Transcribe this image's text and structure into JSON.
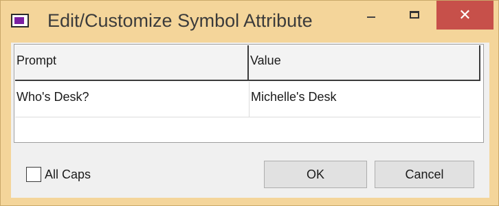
{
  "window": {
    "title": "Edit/Customize Symbol Attribute",
    "app_icon": "app-window-icon",
    "controls": {
      "minimize_icon": "minimize-icon",
      "maximize_icon": "maximize-icon",
      "close_glyph": "✕"
    },
    "colors": {
      "frame": "#f4d59a",
      "close_button": "#c7504a",
      "icon_accent": "#7b1fa2"
    }
  },
  "grid": {
    "columns": [
      "Prompt",
      "Value"
    ],
    "rows": [
      {
        "prompt": "Who's Desk?",
        "value": "Michelle's Desk"
      }
    ]
  },
  "options": {
    "all_caps_label": "All Caps",
    "all_caps_checked": false
  },
  "buttons": {
    "ok_label": "OK",
    "cancel_label": "Cancel"
  }
}
